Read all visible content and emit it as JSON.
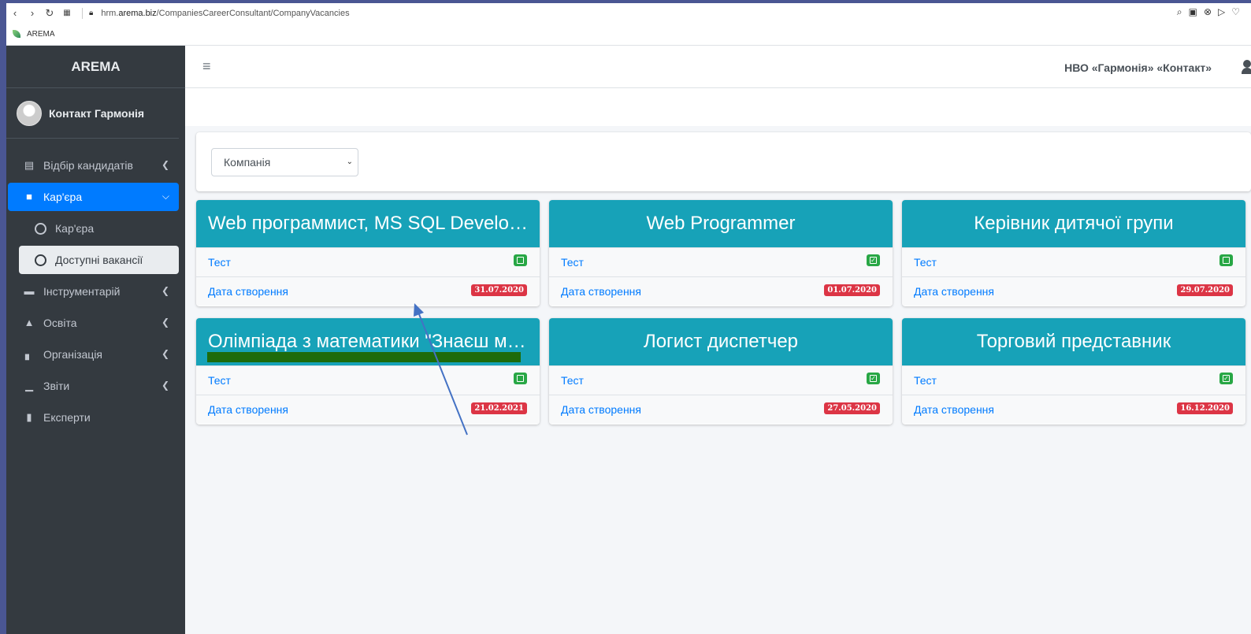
{
  "browser": {
    "url_prefix": "hrm.",
    "url_host": "arema.biz",
    "url_path": "/CompaniesCareerConsultant/CompanyVacancies",
    "bookmark": "AREMA"
  },
  "sidebar": {
    "brand": "AREMA",
    "user": "Контакт Гармонія",
    "items": [
      {
        "label": "Відбір кандидатів",
        "icon": "address-card-icon"
      },
      {
        "label": "Кар'єра",
        "icon": "briefcase-icon"
      },
      {
        "label": "Кар'єра",
        "icon": "circle-icon"
      },
      {
        "label": "Доступні вакансії",
        "icon": "circle-icon"
      },
      {
        "label": "Інструментарій",
        "icon": "toolbox-icon"
      },
      {
        "label": "Освіта",
        "icon": "graduate-icon"
      },
      {
        "label": "Організація",
        "icon": "industry-icon"
      },
      {
        "label": "Звіти",
        "icon": "chart-icon"
      },
      {
        "label": "Експерти",
        "icon": "id-badge-icon"
      }
    ]
  },
  "navbar": {
    "company": "НВО «Гармонія» «Контакт»"
  },
  "filter": {
    "company_select": "Компанія"
  },
  "vacancies": [
    {
      "title": "Web программист, MS SQL Developer",
      "test": "Тест",
      "date_label": "Дата створення",
      "date": "31.07.2020",
      "checked": false
    },
    {
      "title": "Web Programmer",
      "test": "Тест",
      "date_label": "Дата створення",
      "date": "01.07.2020",
      "checked": true
    },
    {
      "title": "Керівник дитячої групи",
      "test": "Тест",
      "date_label": "Дата створення",
      "date": "29.07.2020",
      "checked": false
    },
    {
      "title": "Олімпіада з математики \"Знаєш математику\"",
      "test": "Тест",
      "date_label": "Дата створення",
      "date": "21.02.2021",
      "checked": false
    },
    {
      "title": "Логист диспетчер",
      "test": "Тест",
      "date_label": "Дата створення",
      "date": "27.05.2020",
      "checked": true
    },
    {
      "title": "Торговий представник",
      "test": "Тест",
      "date_label": "Дата створення",
      "date": "16.12.2020",
      "checked": true
    }
  ],
  "colors": {
    "sidebar": "#343a40",
    "active": "#007bff",
    "card_header": "#17a2b8",
    "badge_danger": "#dc3545",
    "check_success": "#28a745",
    "annotation_arrow": "#4472c4",
    "annotation_highlight": "#1e6b0a"
  }
}
